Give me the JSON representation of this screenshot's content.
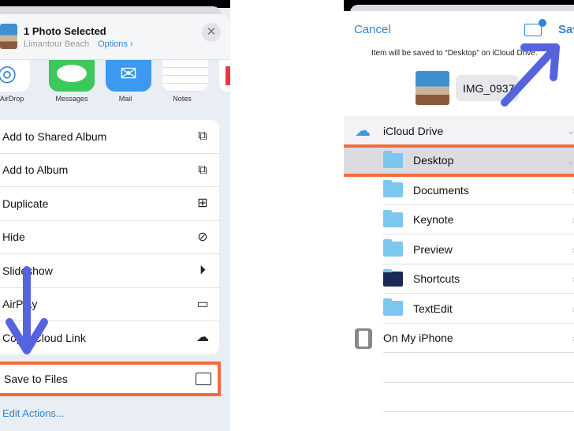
{
  "share_sheet": {
    "title": "1 Photo Selected",
    "location": "Limantour Beach",
    "options_label": "Options ›",
    "close_icon": "close-icon",
    "apps": [
      {
        "label": "AirDrop",
        "icon": "airdrop-icon"
      },
      {
        "label": "Messages",
        "icon": "messages-icon"
      },
      {
        "label": "Mail",
        "icon": "mail-icon"
      },
      {
        "label": "Notes",
        "icon": "notes-icon"
      }
    ],
    "actions": [
      {
        "label": "Add to Shared Album",
        "icon": "shared-album-icon"
      },
      {
        "label": "Add to Album",
        "icon": "add-album-icon"
      },
      {
        "label": "Duplicate",
        "icon": "duplicate-icon"
      },
      {
        "label": "Hide",
        "icon": "hide-eye-icon"
      },
      {
        "label": "Slideshow",
        "icon": "play-icon"
      },
      {
        "label": "AirPlay",
        "icon": "airplay-icon"
      },
      {
        "label": "Copy iCloud Link",
        "icon": "cloud-link-icon"
      }
    ],
    "save_to_files": "Save to Files",
    "edit_actions": "Edit Actions..."
  },
  "files_picker": {
    "cancel": "Cancel",
    "save": "Save",
    "info": "Item will be saved to “Desktop” on iCloud Drive.",
    "filename": "IMG_0937",
    "locations": [
      {
        "label": "iCloud Drive",
        "level": 0
      },
      {
        "label": "Desktop",
        "level": 1,
        "selected": true
      },
      {
        "label": "Documents",
        "level": 1
      },
      {
        "label": "Keynote",
        "level": 1
      },
      {
        "label": "Preview",
        "level": 1
      },
      {
        "label": "Shortcuts",
        "level": 1
      },
      {
        "label": "TextEdit",
        "level": 1
      },
      {
        "label": "On My iPhone",
        "level": 0
      }
    ]
  },
  "colors": {
    "accent": "#2f86d6",
    "highlight": "#f26c3a",
    "arrow": "#5563de"
  }
}
